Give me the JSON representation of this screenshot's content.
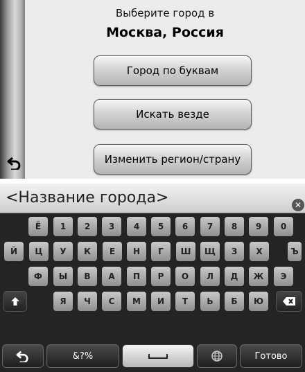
{
  "top": {
    "prompt": "Выберите город в",
    "location": "Москва, Россия",
    "buttons": {
      "by_letters": "Город по буквам",
      "search_everywhere": "Искать везде",
      "change_region": "Изменить регион/страну"
    }
  },
  "keyboard": {
    "input_placeholder": "<Название города>",
    "rows": [
      [
        "Ё",
        "1",
        "2",
        "3",
        "4",
        "5",
        "6",
        "7",
        "8",
        "9",
        "0"
      ],
      [
        "Й",
        "Ц",
        "У",
        "К",
        "Е",
        "Н",
        "Г",
        "Ш",
        "Щ",
        "З",
        "Х",
        "Ъ"
      ],
      [
        "Ф",
        "Ы",
        "В",
        "А",
        "П",
        "Р",
        "О",
        "Л",
        "Д",
        "Ж",
        "Э"
      ],
      [
        "Я",
        "Ч",
        "С",
        "М",
        "И",
        "Т",
        "Ь",
        "Б",
        "Ю"
      ]
    ],
    "symbols_label": "&?%",
    "done_label": "Готово"
  }
}
